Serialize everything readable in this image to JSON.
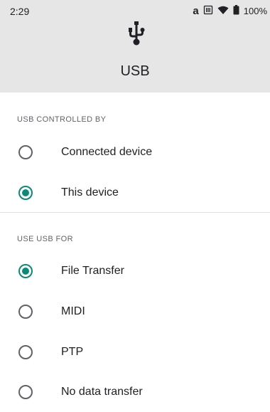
{
  "status_bar": {
    "time": "2:29",
    "icons": [
      "a-icon",
      "sim-icon",
      "wifi-icon",
      "battery-icon"
    ],
    "a_text": "a",
    "battery": "100%"
  },
  "header": {
    "title": "USB",
    "icon": "usb-icon"
  },
  "sections": {
    "controlled_by": {
      "header": "USB CONTROLLED BY",
      "options": [
        {
          "label": "Connected device",
          "checked": false
        },
        {
          "label": "This device",
          "checked": true
        }
      ]
    },
    "use_for": {
      "header": "USE USB FOR",
      "options": [
        {
          "label": "File Transfer",
          "checked": true
        },
        {
          "label": "MIDI",
          "checked": false
        },
        {
          "label": "PTP",
          "checked": false
        },
        {
          "label": "No data transfer",
          "checked": false
        }
      ]
    }
  },
  "colors": {
    "accent": "#0b8a77",
    "header_bg": "#e6e6e6"
  }
}
